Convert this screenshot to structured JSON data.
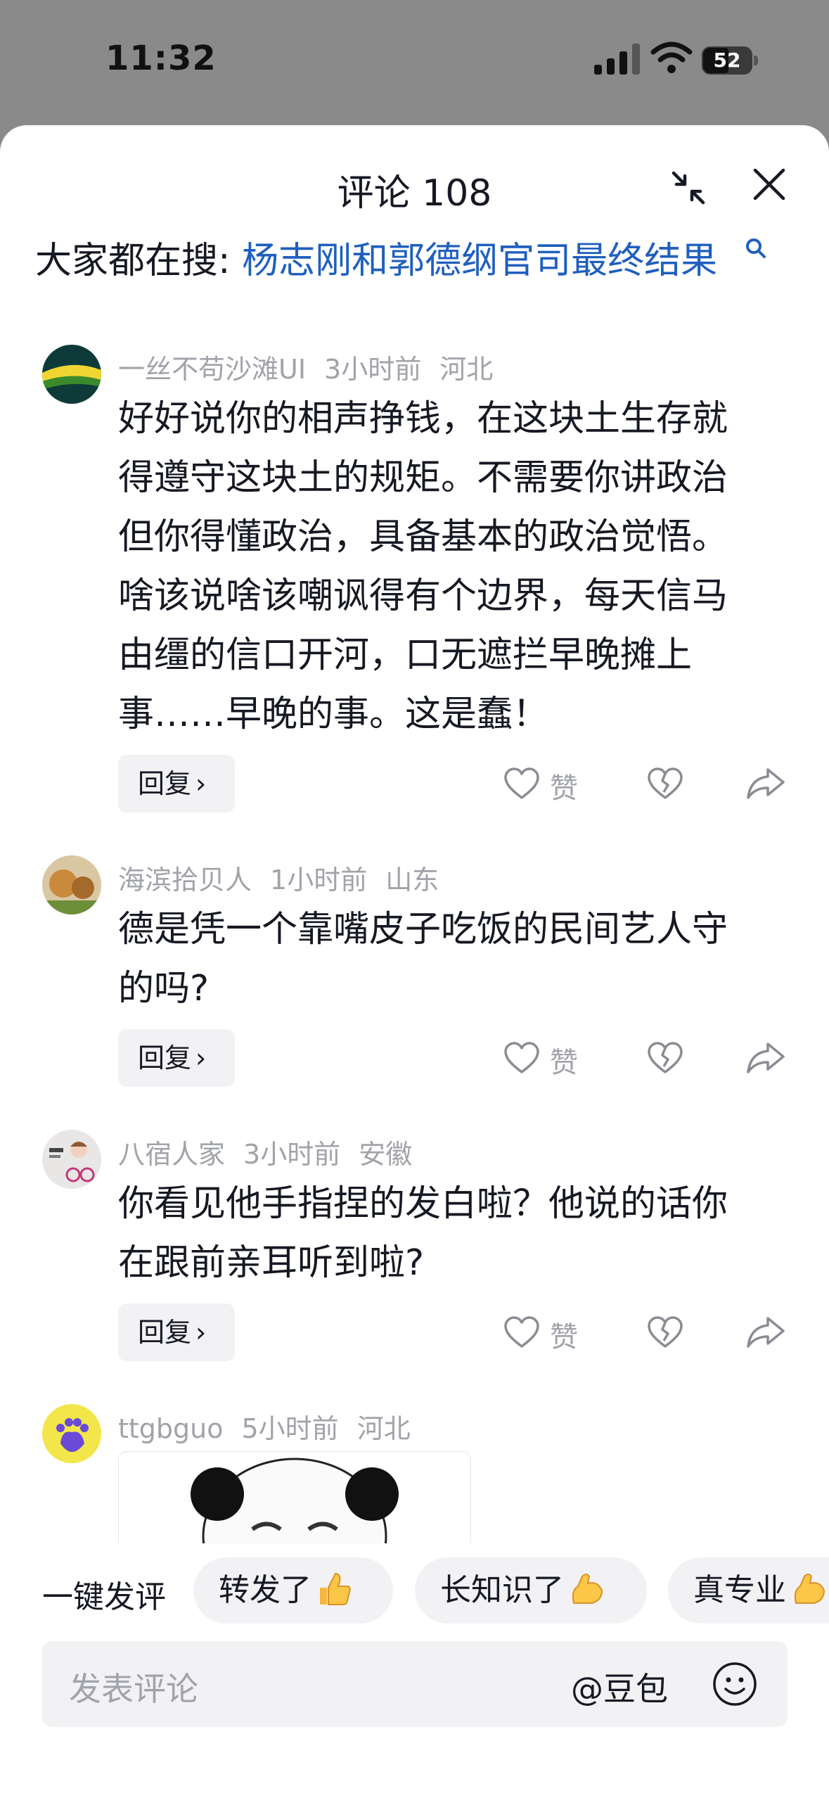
{
  "status_bar": {
    "time": "11:32",
    "battery": "52"
  },
  "sheet": {
    "title": "评论 108",
    "trending_prefix": "大家都在搜: ",
    "trending_query": "杨志刚和郭德纲官司最终结果"
  },
  "comments": [
    {
      "username": "一丝不苟沙滩UI",
      "time": "3小时前",
      "location": "河北",
      "lines": [
        "好好说你的相声挣钱，在这块土生存就",
        "得遵守这块土的规矩。不需要你讲政治",
        "但你得懂政治，具备基本的政治觉悟。",
        "啥该说啥该嘲讽得有个边界，每天信马",
        "由缰的信口开河，口无遮拦早晚摊上",
        "事……早晚的事。这是蠢！"
      ],
      "reply_label": "回复",
      "like_label": "赞"
    },
    {
      "username": "海滨拾贝人",
      "time": "1小时前",
      "location": "山东",
      "lines": [
        "德是凭一个靠嘴皮子吃饭的民间艺人守",
        "的吗?"
      ],
      "reply_label": "回复",
      "like_label": "赞"
    },
    {
      "username": "八宿人家",
      "time": "3小时前",
      "location": "安徽",
      "lines": [
        "你看见他手指捏的发白啦？他说的话你",
        "在跟前亲耳听到啦?"
      ],
      "reply_label": "回复",
      "like_label": "赞"
    },
    {
      "username": "ttgbguo",
      "time": "5小时前",
      "location": "河北"
    }
  ],
  "quick_reply": {
    "label": "一键发评",
    "chips": [
      "转发了",
      "长知识了",
      "真专业"
    ]
  },
  "input": {
    "placeholder": "发表评论",
    "mention": "@豆包"
  },
  "colors": {
    "link_blue": "#1f5fbf",
    "meta_gray": "#a1a3aa",
    "chip_bg": "#f2f2f4"
  }
}
